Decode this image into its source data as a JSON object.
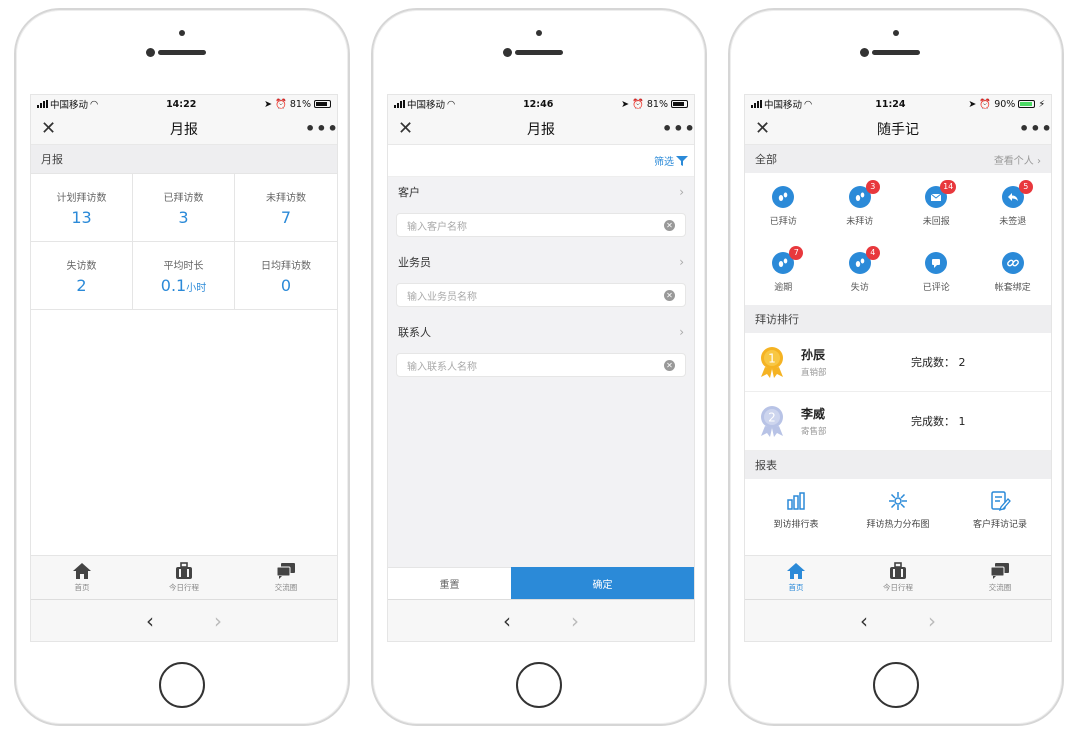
{
  "phone1": {
    "status": {
      "carrier": "中国移动",
      "time": "14:22",
      "battery": "81%"
    },
    "nav": {
      "close": "✕",
      "title": "月报",
      "more": "•••"
    },
    "section": "月报",
    "stats": [
      {
        "label": "计划拜访数",
        "value": "13",
        "unit": ""
      },
      {
        "label": "已拜访数",
        "value": "3",
        "unit": ""
      },
      {
        "label": "未拜访数",
        "value": "7",
        "unit": ""
      },
      {
        "label": "失访数",
        "value": "2",
        "unit": ""
      },
      {
        "label": "平均时长",
        "value": "0.1",
        "unit": "小时"
      },
      {
        "label": "日均拜访数",
        "value": "0",
        "unit": ""
      }
    ],
    "tabs": [
      {
        "label": "首页"
      },
      {
        "label": "今日行程"
      },
      {
        "label": "交流圈"
      }
    ],
    "browser": {
      "back": "‹",
      "forward": "›"
    }
  },
  "phone2": {
    "status": {
      "carrier": "中国移动",
      "time": "12:46",
      "battery": "81%"
    },
    "nav": {
      "close": "✕",
      "title": "月报",
      "more": "•••"
    },
    "filter": "筛选",
    "fields": [
      {
        "label": "客户",
        "placeholder": "输入客户名称"
      },
      {
        "label": "业务员",
        "placeholder": "输入业务员名称"
      },
      {
        "label": "联系人",
        "placeholder": "输入联系人名称"
      }
    ],
    "reset": "重置",
    "confirm": "确定",
    "browser": {
      "back": "‹",
      "forward": "›"
    }
  },
  "phone3": {
    "status": {
      "carrier": "中国移动",
      "time": "11:24",
      "battery": "90%"
    },
    "nav": {
      "close": "✕",
      "title": "随手记",
      "more": "•••"
    },
    "section_all": "全部",
    "view_personal": "查看个人",
    "grid": [
      {
        "label": "已拜访",
        "badge": "",
        "icon": "footprint-icon"
      },
      {
        "label": "未拜访",
        "badge": "3",
        "icon": "footprint-icon"
      },
      {
        "label": "未回报",
        "badge": "14",
        "icon": "mail-icon"
      },
      {
        "label": "未签退",
        "badge": "5",
        "icon": "return-arrow-icon"
      },
      {
        "label": "逾期",
        "badge": "7",
        "icon": "footprint-icon"
      },
      {
        "label": "失访",
        "badge": "4",
        "icon": "footprint-icon"
      },
      {
        "label": "已评论",
        "badge": "",
        "icon": "comment-icon"
      },
      {
        "label": "帐套绑定",
        "badge": "",
        "icon": "link-icon"
      }
    ],
    "section_rank": "拜访排行",
    "ranking": [
      {
        "rank": "1",
        "name": "孙辰",
        "dept": "直销部",
        "done_label": "完成数：",
        "done": "2",
        "color": "#f5b323"
      },
      {
        "rank": "2",
        "name": "李威",
        "dept": "寄售部",
        "done_label": "完成数：",
        "done": "1",
        "color": "#b8c3e6"
      }
    ],
    "section_report": "报表",
    "reports": [
      {
        "label": "到访排行表",
        "icon": "bar-chart-icon"
      },
      {
        "label": "拜访热力分布图",
        "icon": "heatmap-icon"
      },
      {
        "label": "客户拜访记录",
        "icon": "record-edit-icon"
      }
    ],
    "tabs": [
      {
        "label": "首页"
      },
      {
        "label": "今日行程"
      },
      {
        "label": "交流圈"
      }
    ],
    "browser": {
      "back": "‹",
      "forward": "›"
    },
    "accent": "#2b8ad8"
  }
}
